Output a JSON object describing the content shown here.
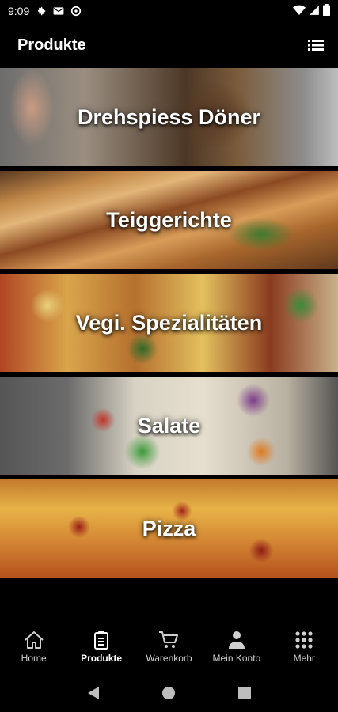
{
  "status_bar": {
    "time": "9:09",
    "icons": [
      "gear-icon",
      "gmail-icon",
      "settings-icon",
      "wifi-icon",
      "signal-icon",
      "battery-icon"
    ]
  },
  "app_bar": {
    "title": "Produkte",
    "menu_icon": "list-icon"
  },
  "categories": [
    {
      "label": "Drehspiess Döner"
    },
    {
      "label": "Teiggerichte"
    },
    {
      "label": "Vegi. Spezialitäten"
    },
    {
      "label": "Salate"
    },
    {
      "label": "Pizza"
    }
  ],
  "bottom_nav": {
    "items": [
      {
        "label": "Home",
        "icon": "home-icon"
      },
      {
        "label": "Produkte",
        "icon": "clipboard-icon",
        "active": true
      },
      {
        "label": "Warenkorb",
        "icon": "cart-icon"
      },
      {
        "label": "Mein Konto",
        "icon": "person-icon"
      },
      {
        "label": "Mehr",
        "icon": "grid-icon"
      }
    ]
  },
  "colors": {
    "background": "#000000",
    "text": "#ffffff",
    "inactive_nav": "#cfcfcf"
  }
}
